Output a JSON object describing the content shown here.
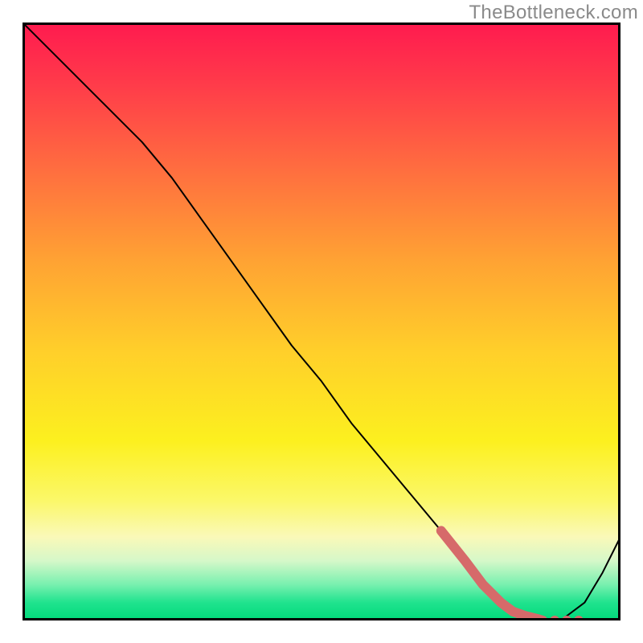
{
  "watermark": "TheBottleneck.com",
  "chart_data": {
    "type": "line",
    "title": "",
    "xlabel": "",
    "ylabel": "",
    "xlim": [
      0,
      100
    ],
    "ylim": [
      0,
      100
    ],
    "grid": false,
    "legend": false,
    "series": [
      {
        "name": "bottleneck-curve",
        "color": "#000000",
        "x": [
          0,
          3,
          7,
          12,
          16,
          20,
          25,
          30,
          35,
          40,
          45,
          50,
          55,
          60,
          65,
          70,
          74,
          77,
          80,
          83,
          86,
          90,
          94,
          97,
          100
        ],
        "values": [
          100,
          97,
          93,
          88,
          84,
          80,
          74,
          67,
          60,
          53,
          46,
          40,
          33,
          27,
          21,
          15,
          10,
          6,
          3,
          1,
          0,
          0,
          3,
          8,
          14
        ]
      },
      {
        "name": "highlight-segment",
        "color": "#d66a6a",
        "style": "thick",
        "x": [
          70,
          74,
          77,
          80,
          82,
          84,
          86,
          87
        ],
        "values": [
          15,
          10,
          6,
          3,
          1.5,
          0.8,
          0.3,
          0
        ]
      },
      {
        "name": "highlight-dots",
        "color": "#d66a6a",
        "style": "dots",
        "x": [
          89,
          91,
          93
        ],
        "values": [
          0,
          0,
          0
        ]
      }
    ],
    "background_gradient": {
      "top": "#ff1a4f",
      "mid": "#ffd028",
      "bottom": "#00d97a"
    }
  }
}
